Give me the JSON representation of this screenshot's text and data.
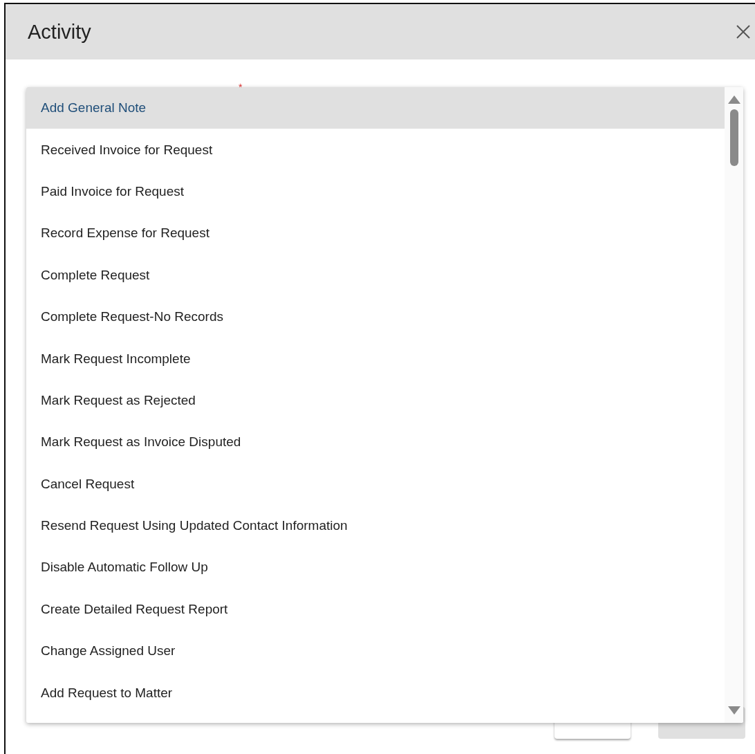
{
  "dialog": {
    "title": "Activity",
    "required_mark": "*"
  },
  "dropdown": {
    "items": [
      {
        "label": "Add General Note",
        "selected": true
      },
      {
        "label": "Received Invoice for Request",
        "selected": false
      },
      {
        "label": "Paid Invoice for Request",
        "selected": false
      },
      {
        "label": "Record Expense for Request",
        "selected": false
      },
      {
        "label": "Complete Request",
        "selected": false
      },
      {
        "label": "Complete Request-No Records",
        "selected": false
      },
      {
        "label": "Mark Request Incomplete",
        "selected": false
      },
      {
        "label": "Mark Request as Rejected",
        "selected": false
      },
      {
        "label": "Mark Request as Invoice Disputed",
        "selected": false
      },
      {
        "label": "Cancel Request",
        "selected": false
      },
      {
        "label": "Resend Request Using Updated Contact Information",
        "selected": false
      },
      {
        "label": "Disable Automatic Follow Up",
        "selected": false
      },
      {
        "label": "Create Detailed Request Report",
        "selected": false
      },
      {
        "label": "Change Assigned User",
        "selected": false
      },
      {
        "label": "Add Request to Matter",
        "selected": false
      }
    ]
  },
  "buttons": [
    {
      "disabled": false
    },
    {
      "disabled": true
    }
  ]
}
